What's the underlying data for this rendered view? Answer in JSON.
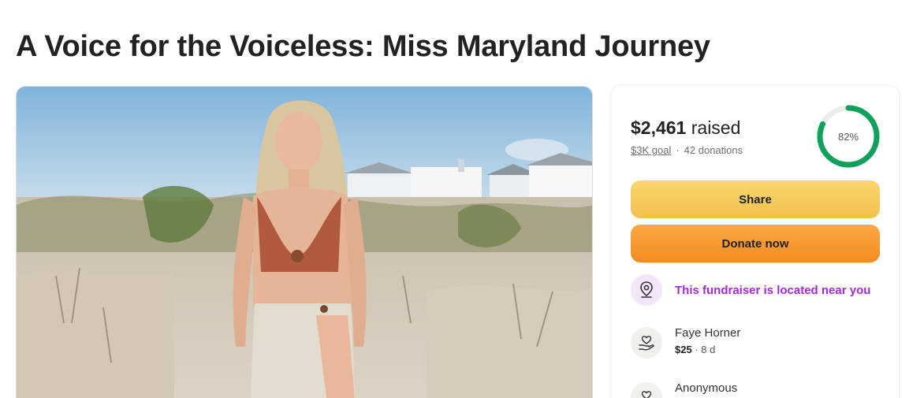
{
  "page": {
    "title": "A Voice for the Voiceless: Miss Maryland Journey"
  },
  "stats": {
    "raised_amount": "$2,461",
    "raised_suffix": "raised",
    "goal": "$3K goal",
    "separator": "·",
    "donations": "42 donations",
    "progress_label": "82%",
    "progress_fraction": 0.82,
    "progress_color": "#0fa05c",
    "track_color": "#ededed"
  },
  "actions": {
    "share_label": "Share",
    "donate_label": "Donate now"
  },
  "location": {
    "text": "This fundraiser is located near you",
    "icon": "location-pin-icon"
  },
  "donors": [
    {
      "name": "Faye Horner",
      "amount": "$25",
      "time": "· 8 d",
      "icon": "heart-hand-icon"
    },
    {
      "name": "Anonymous",
      "amount": "",
      "time": "",
      "icon": "heart-hand-icon"
    }
  ]
}
